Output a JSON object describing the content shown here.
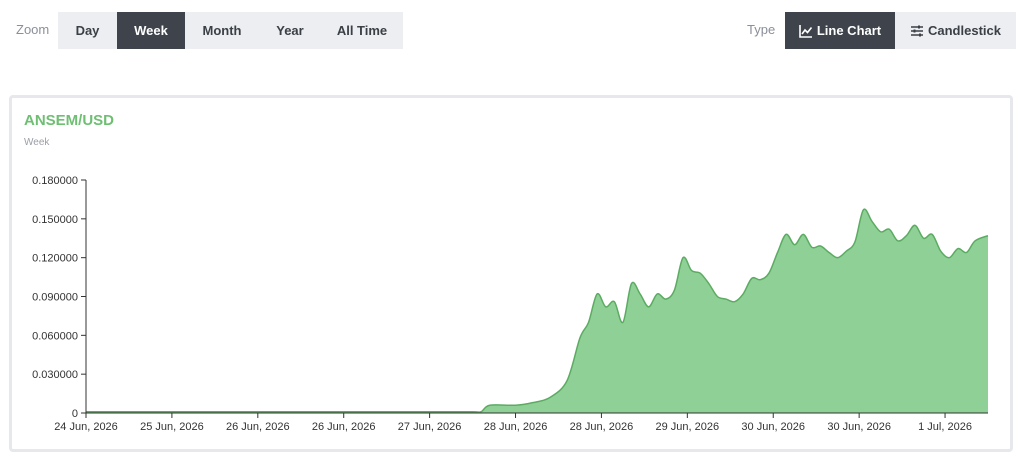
{
  "toolbar": {
    "zoom_label": "Zoom",
    "zoom_options": [
      {
        "label": "Day",
        "active": false
      },
      {
        "label": "Week",
        "active": true
      },
      {
        "label": "Month",
        "active": false
      },
      {
        "label": "Year",
        "active": false
      },
      {
        "label": "All Time",
        "active": false
      }
    ],
    "type_label": "Type",
    "type_options": [
      {
        "label": "Line Chart",
        "icon": "line-chart-icon",
        "active": true
      },
      {
        "label": "Candlestick",
        "icon": "sliders-icon",
        "active": false
      }
    ]
  },
  "colors": {
    "accent": "#6fbf73",
    "area_fill": "#8fd096",
    "area_line": "#5cab62",
    "active_button": "#3f444c",
    "button_bg": "#eceef1"
  },
  "chart_data": {
    "type": "area",
    "title": "ANSEM/USD",
    "subtitle": "Week",
    "xlabel": "",
    "ylabel": "",
    "ylim": [
      0,
      0.18
    ],
    "y_ticks": [
      "0",
      "0.030000",
      "0.060000",
      "0.090000",
      "0.120000",
      "0.150000",
      "0.180000"
    ],
    "y_tick_values": [
      0,
      0.03,
      0.06,
      0.09,
      0.12,
      0.15,
      0.18
    ],
    "x_ticks": [
      "24 Jun, 2026",
      "25 Jun, 2026",
      "26 Jun, 2026",
      "26 Jun, 2026",
      "27 Jun, 2026",
      "28 Jun, 2026",
      "28 Jun, 2026",
      "29 Jun, 2026",
      "30 Jun, 2026",
      "30 Jun, 2026",
      "1 Jul, 2026"
    ],
    "x_tick_index": [
      0,
      1,
      2,
      3,
      4,
      5,
      6,
      7,
      8,
      9,
      10
    ],
    "xlim": [
      0,
      10.5
    ],
    "grid": false,
    "legend": "none",
    "series": [
      {
        "x": [
          0,
          0.5,
          1,
          1.5,
          2,
          2.5,
          3,
          3.5,
          4,
          4.5,
          4.6,
          4.7,
          5,
          5.2,
          5.4,
          5.6,
          5.75,
          5.85,
          5.95,
          6.05,
          6.15,
          6.25,
          6.35,
          6.45,
          6.55,
          6.65,
          6.75,
          6.85,
          6.95,
          7.05,
          7.15,
          7.25,
          7.35,
          7.45,
          7.55,
          7.65,
          7.75,
          7.85,
          7.95,
          8.05,
          8.15,
          8.25,
          8.35,
          8.45,
          8.55,
          8.65,
          8.75,
          8.85,
          8.95,
          9.05,
          9.15,
          9.25,
          9.35,
          9.45,
          9.55,
          9.65,
          9.75,
          9.85,
          9.95,
          10.05,
          10.15,
          10.25,
          10.35,
          10.5
        ],
        "values": [
          0.001,
          0.001,
          0.001,
          0.001,
          0.001,
          0.001,
          0.001,
          0.001,
          0.001,
          0.001,
          0.001,
          0.006,
          0.006,
          0.008,
          0.012,
          0.025,
          0.058,
          0.07,
          0.092,
          0.082,
          0.086,
          0.07,
          0.1,
          0.092,
          0.082,
          0.092,
          0.088,
          0.095,
          0.12,
          0.11,
          0.108,
          0.1,
          0.09,
          0.088,
          0.086,
          0.092,
          0.104,
          0.103,
          0.108,
          0.124,
          0.138,
          0.13,
          0.138,
          0.128,
          0.129,
          0.124,
          0.12,
          0.125,
          0.132,
          0.157,
          0.148,
          0.14,
          0.142,
          0.133,
          0.137,
          0.145,
          0.135,
          0.138,
          0.125,
          0.12,
          0.127,
          0.124,
          0.133,
          0.137
        ]
      }
    ]
  }
}
